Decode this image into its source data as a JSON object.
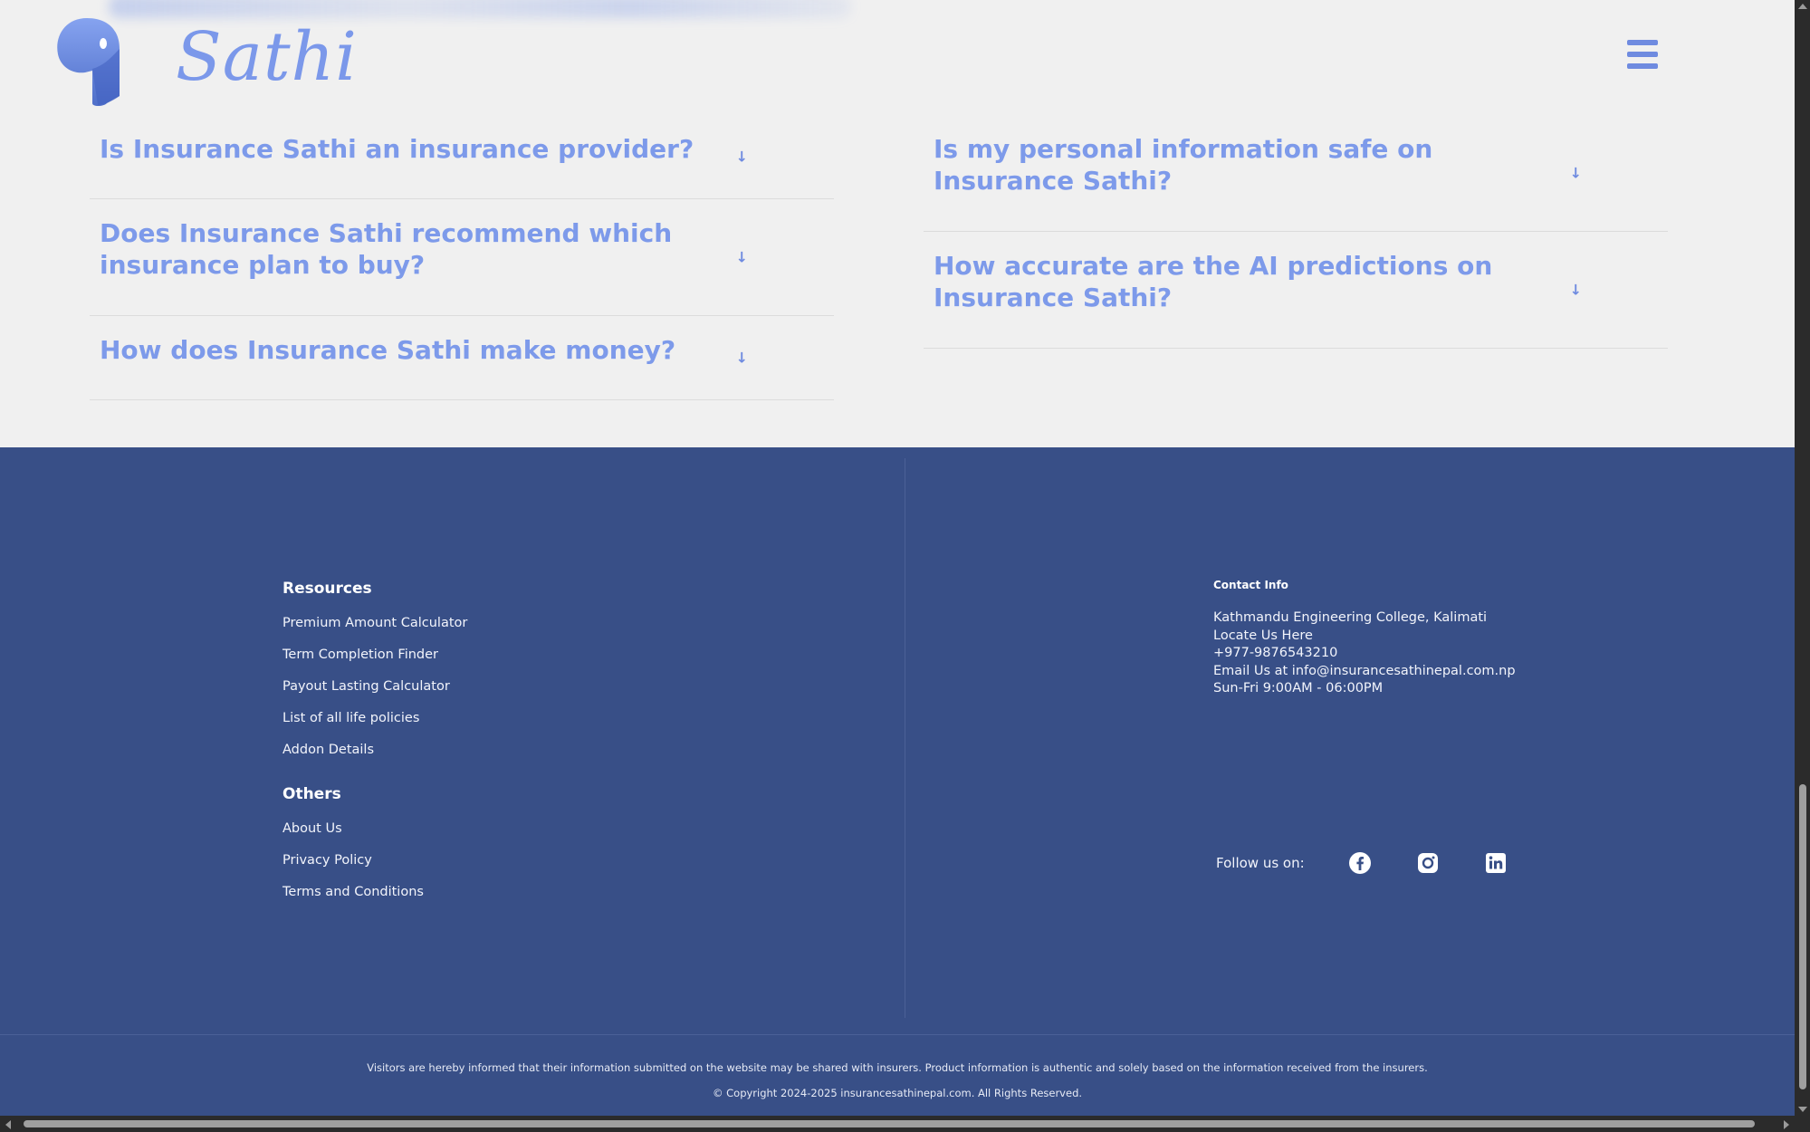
{
  "header": {
    "logo_text": "Sathi",
    "menu_icon": "hamburger-menu-icon"
  },
  "faq": {
    "left": [
      {
        "question": "Is Insurance Sathi an insurance provider?"
      },
      {
        "question": "Does Insurance Sathi recommend which insurance plan to buy?"
      },
      {
        "question": "How does Insurance Sathi make money?"
      }
    ],
    "right": [
      {
        "question": "Is my personal information safe on Insurance Sathi?"
      },
      {
        "question": "How accurate are the AI predictions on Insurance Sathi?"
      }
    ],
    "arrow_glyph": "↓"
  },
  "footer": {
    "resources": {
      "heading": "Resources",
      "links": [
        "Premium Amount Calculator",
        "Term Completion Finder",
        "Payout Lasting Calculator",
        "List of all life policies",
        "Addon Details"
      ]
    },
    "others": {
      "heading": "Others",
      "links": [
        "About Us",
        "Privacy Policy",
        "Terms and Conditions"
      ]
    },
    "contact": {
      "heading": "Contact Info",
      "address": "Kathmandu Engineering College, Kalimati",
      "locate": "Locate Us Here",
      "phone": "+977-9876543210",
      "email": "Email Us at info@insurancesathinepal.com.np",
      "hours": "Sun-Fri 9:00AM - 06:00PM"
    },
    "follow": {
      "label": "Follow us on:",
      "icons": [
        "facebook-icon",
        "instagram-icon",
        "linkedin-icon"
      ]
    },
    "disclaimer": "Visitors are hereby informed that their information submitted on the website may be shared with insurers. Product information is authentic and solely based on the information received from the insurers.",
    "copyright": "© Copyright 2024-2025 insurancesathinepal.com. All Rights Reserved."
  },
  "colors": {
    "accent": "#7d9aea",
    "footer_bg": "#384f87",
    "page_bg": "#f0f0f0"
  }
}
